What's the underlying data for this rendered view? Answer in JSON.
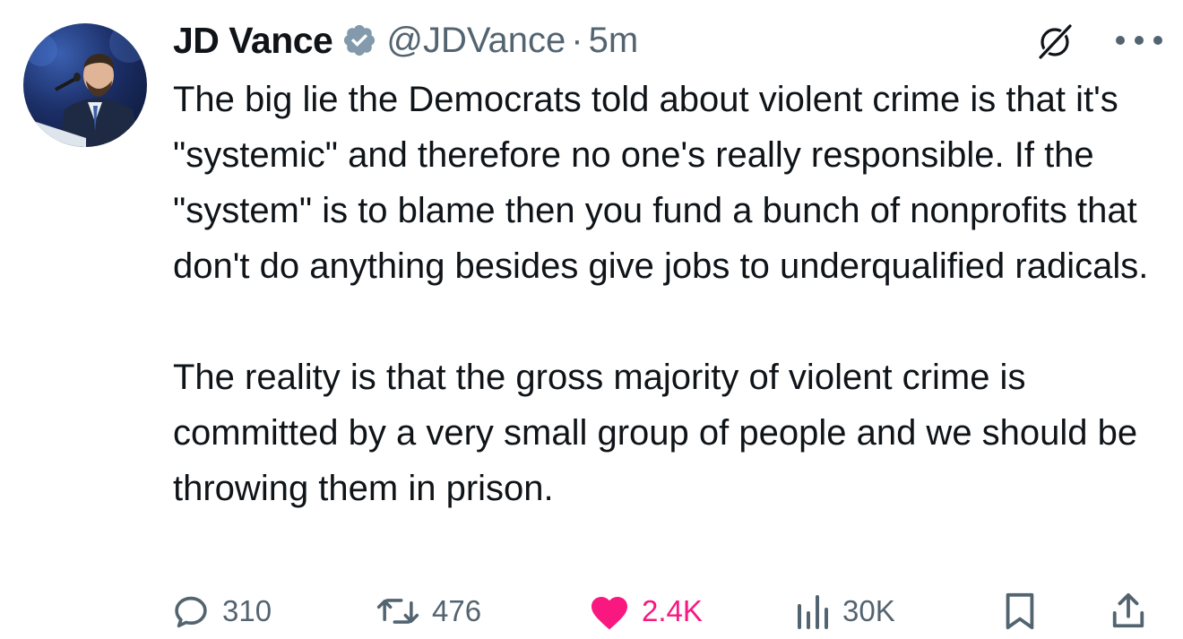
{
  "tweet": {
    "author": {
      "display_name": "JD Vance",
      "handle": "@JDVance",
      "verified": true
    },
    "separator": "·",
    "time": "5m",
    "paragraphs": [
      "The big lie the Democrats told about violent crime is that it's \"systemic\" and therefore no one's really responsible. If the \"system\" is to blame then you fund a bunch of nonprofits that don't do anything besides give jobs to underqualified radicals.",
      "The reality is that the gross majority of violent crime is committed by a very small group of people and we should be throwing them in prison."
    ]
  },
  "actions": {
    "replies": "310",
    "reposts": "476",
    "likes": "2.4K",
    "views": "30K"
  },
  "icons": {
    "reply": "reply-icon",
    "repost": "repost-icon",
    "like": "heart-icon",
    "views": "views-icon",
    "bookmark": "bookmark-icon",
    "share": "share-icon",
    "grok": "grok-icon",
    "more": "more-icon",
    "verified": "verified-badge-icon"
  },
  "colors": {
    "text": "#0f1419",
    "secondary": "#536471",
    "like": "#f91880",
    "verified": "#829aab"
  }
}
